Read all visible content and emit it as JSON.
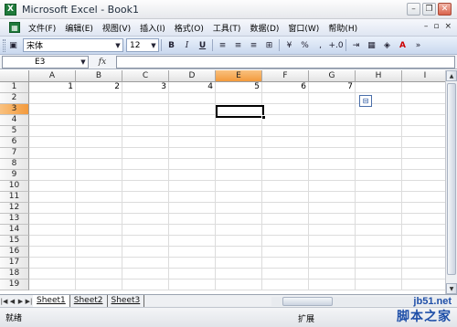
{
  "window": {
    "title": "Microsoft Excel - Book1",
    "app_icon": "X"
  },
  "menu": {
    "items": [
      "文件(F)",
      "编辑(E)",
      "视图(V)",
      "插入(I)",
      "格式(O)",
      "工具(T)",
      "数据(D)",
      "窗口(W)",
      "帮助(H)"
    ],
    "right_controls": [
      "–",
      "▫",
      "×"
    ]
  },
  "toolbar": {
    "font": "宋体",
    "size": "12",
    "bold": "B",
    "italic": "I",
    "underline": "U",
    "percent": "%",
    "comma": ",",
    "decimals": "+.0",
    "fill_label": "A"
  },
  "formula_bar": {
    "name_box": "E3",
    "fx": "fx",
    "value": ""
  },
  "grid": {
    "columns": [
      "A",
      "B",
      "C",
      "D",
      "E",
      "F",
      "G",
      "H",
      "I"
    ],
    "active_column": "E",
    "rows": [
      {
        "n": "1",
        "cells": [
          "1",
          "2",
          "3",
          "4",
          "5",
          "6",
          "7",
          "",
          ""
        ]
      },
      {
        "n": "2",
        "cells": [
          "",
          "",
          "",
          "",
          "",
          "",
          "",
          "",
          ""
        ]
      },
      {
        "n": "3",
        "cells": [
          "",
          "",
          "",
          "",
          "",
          "",
          "",
          "",
          ""
        ]
      },
      {
        "n": "4",
        "cells": [
          "",
          "",
          "",
          "",
          "",
          "",
          "",
          "",
          ""
        ]
      },
      {
        "n": "5",
        "cells": [
          "",
          "",
          "",
          "",
          "",
          "",
          "",
          "",
          ""
        ]
      },
      {
        "n": "6",
        "cells": [
          "",
          "",
          "",
          "",
          "",
          "",
          "",
          "",
          ""
        ]
      },
      {
        "n": "7",
        "cells": [
          "",
          "",
          "",
          "",
          "",
          "",
          "",
          "",
          ""
        ]
      },
      {
        "n": "8",
        "cells": [
          "",
          "",
          "",
          "",
          "",
          "",
          "",
          "",
          ""
        ]
      },
      {
        "n": "9",
        "cells": [
          "",
          "",
          "",
          "",
          "",
          "",
          "",
          "",
          ""
        ]
      },
      {
        "n": "10",
        "cells": [
          "",
          "",
          "",
          "",
          "",
          "",
          "",
          "",
          ""
        ]
      },
      {
        "n": "11",
        "cells": [
          "",
          "",
          "",
          "",
          "",
          "",
          "",
          "",
          ""
        ]
      },
      {
        "n": "12",
        "cells": [
          "",
          "",
          "",
          "",
          "",
          "",
          "",
          "",
          ""
        ]
      },
      {
        "n": "13",
        "cells": [
          "",
          "",
          "",
          "",
          "",
          "",
          "",
          "",
          ""
        ]
      },
      {
        "n": "14",
        "cells": [
          "",
          "",
          "",
          "",
          "",
          "",
          "",
          "",
          ""
        ]
      },
      {
        "n": "15",
        "cells": [
          "",
          "",
          "",
          "",
          "",
          "",
          "",
          "",
          ""
        ]
      },
      {
        "n": "16",
        "cells": [
          "",
          "",
          "",
          "",
          "",
          "",
          "",
          "",
          ""
        ]
      },
      {
        "n": "17",
        "cells": [
          "",
          "",
          "",
          "",
          "",
          "",
          "",
          "",
          ""
        ]
      },
      {
        "n": "18",
        "cells": [
          "",
          "",
          "",
          "",
          "",
          "",
          "",
          "",
          ""
        ]
      },
      {
        "n": "19",
        "cells": [
          "",
          "",
          "",
          "",
          "",
          "",
          "",
          "",
          ""
        ]
      }
    ],
    "active_row": "3"
  },
  "sheets": {
    "tabs": [
      "Sheet1",
      "Sheet2",
      "Sheet3"
    ],
    "active": "Sheet1"
  },
  "status": {
    "ready": "就绪",
    "ext": "扩展"
  },
  "watermark": {
    "line1": "jb51.net",
    "line2": "脚本之家"
  },
  "colors": {
    "active_header": "#f39a3c",
    "menu_bg": "#dfe6f2",
    "toolbar_bg": "#c9d8ee"
  }
}
